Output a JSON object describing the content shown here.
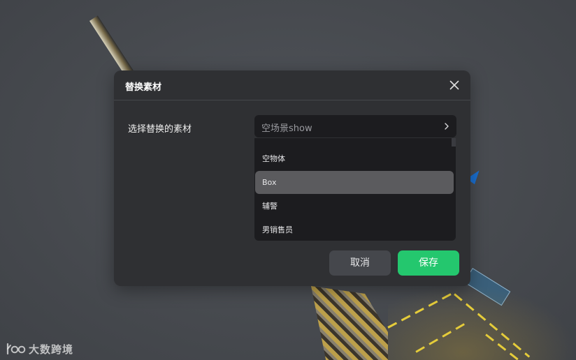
{
  "dialog": {
    "title": "替换素材",
    "close_icon": "close-icon",
    "field_label": "选择替换的素材",
    "select": {
      "value": "空场景show",
      "arrow_icon": "chevron-right-icon"
    },
    "dropdown": {
      "items": [
        {
          "label": "空物体",
          "selected": false
        },
        {
          "label": "Box",
          "selected": true
        },
        {
          "label": "辅警",
          "selected": false
        },
        {
          "label": "男销售员",
          "selected": false
        }
      ]
    },
    "buttons": {
      "cancel_label": "取消",
      "save_label": "保存"
    }
  },
  "watermark": {
    "text": "大数跨境",
    "logo_icon": "brand-logo-icon"
  },
  "colors": {
    "accent": "#24c76e",
    "dialog_bg": "#2f3033",
    "select_bg": "#1c1c1f",
    "selected_item_bg": "#5b5b5e"
  }
}
